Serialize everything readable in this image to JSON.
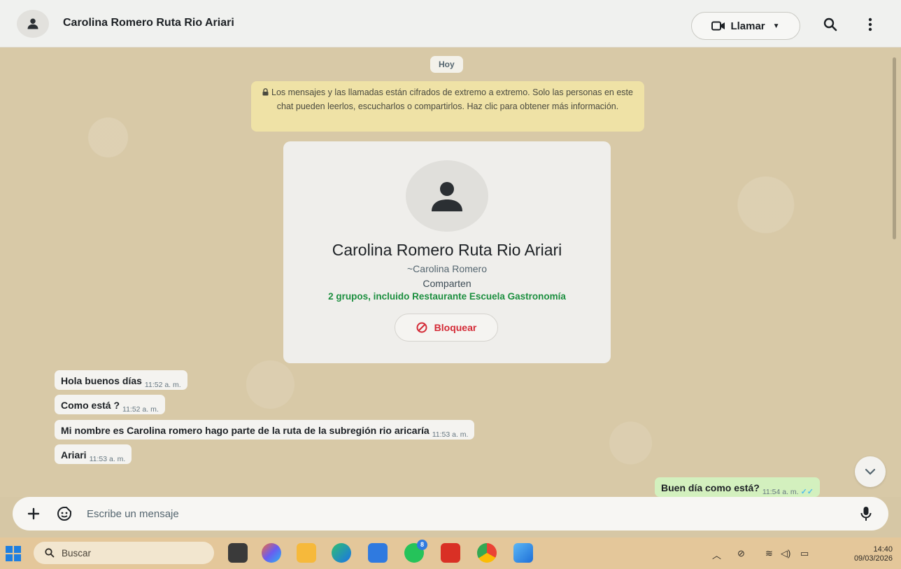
{
  "header": {
    "contact_name": "Carolina Romero Ruta Rio Ariari",
    "call_label": "Llamar"
  },
  "chat": {
    "date_chip": "Hoy",
    "encryption_notice": "Los mensajes y las llamadas están cifrados de extremo a extremo. Solo las personas en este chat pueden leerlos, escucharlos o compartirlos. Haz clic para obtener más información.",
    "contact_card": {
      "name": "Carolina Romero Ruta Rio Ariari",
      "subname": "~Carolina Romero",
      "shared_label": "Comparten",
      "shared_groups": "2 grupos, incluido Restaurante Escuela Gastronomía",
      "block_label": "Bloquear"
    },
    "messages": [
      {
        "text": "Hola buenos días",
        "time": "11:52 a. m.",
        "direction": "in"
      },
      {
        "text": "Como está ?",
        "time": "11:52 a. m.",
        "direction": "in"
      },
      {
        "text": "Mi nombre es Carolina romero hago parte de la ruta  de la subregión rio aricaría",
        "time": "11:53 a. m.",
        "direction": "in"
      },
      {
        "text": "Ariari",
        "time": "11:53 a. m.",
        "direction": "in"
      },
      {
        "text": "Buen día como está?",
        "time": "11:54 a. m.",
        "direction": "out"
      }
    ]
  },
  "composer": {
    "placeholder": "Escribe un mensaje"
  },
  "taskbar": {
    "search_label": "Buscar",
    "clock_time": "14:40",
    "clock_date": "09/03/2026",
    "whatsapp_badge": "8"
  },
  "colors": {
    "outgoing_bubble": "#d3f0be",
    "incoming_bubble": "#f4f3f0",
    "shared_groups_green": "#1c8f3f",
    "block_red": "#d42a36",
    "notice_yellow": "#efe2a6"
  }
}
